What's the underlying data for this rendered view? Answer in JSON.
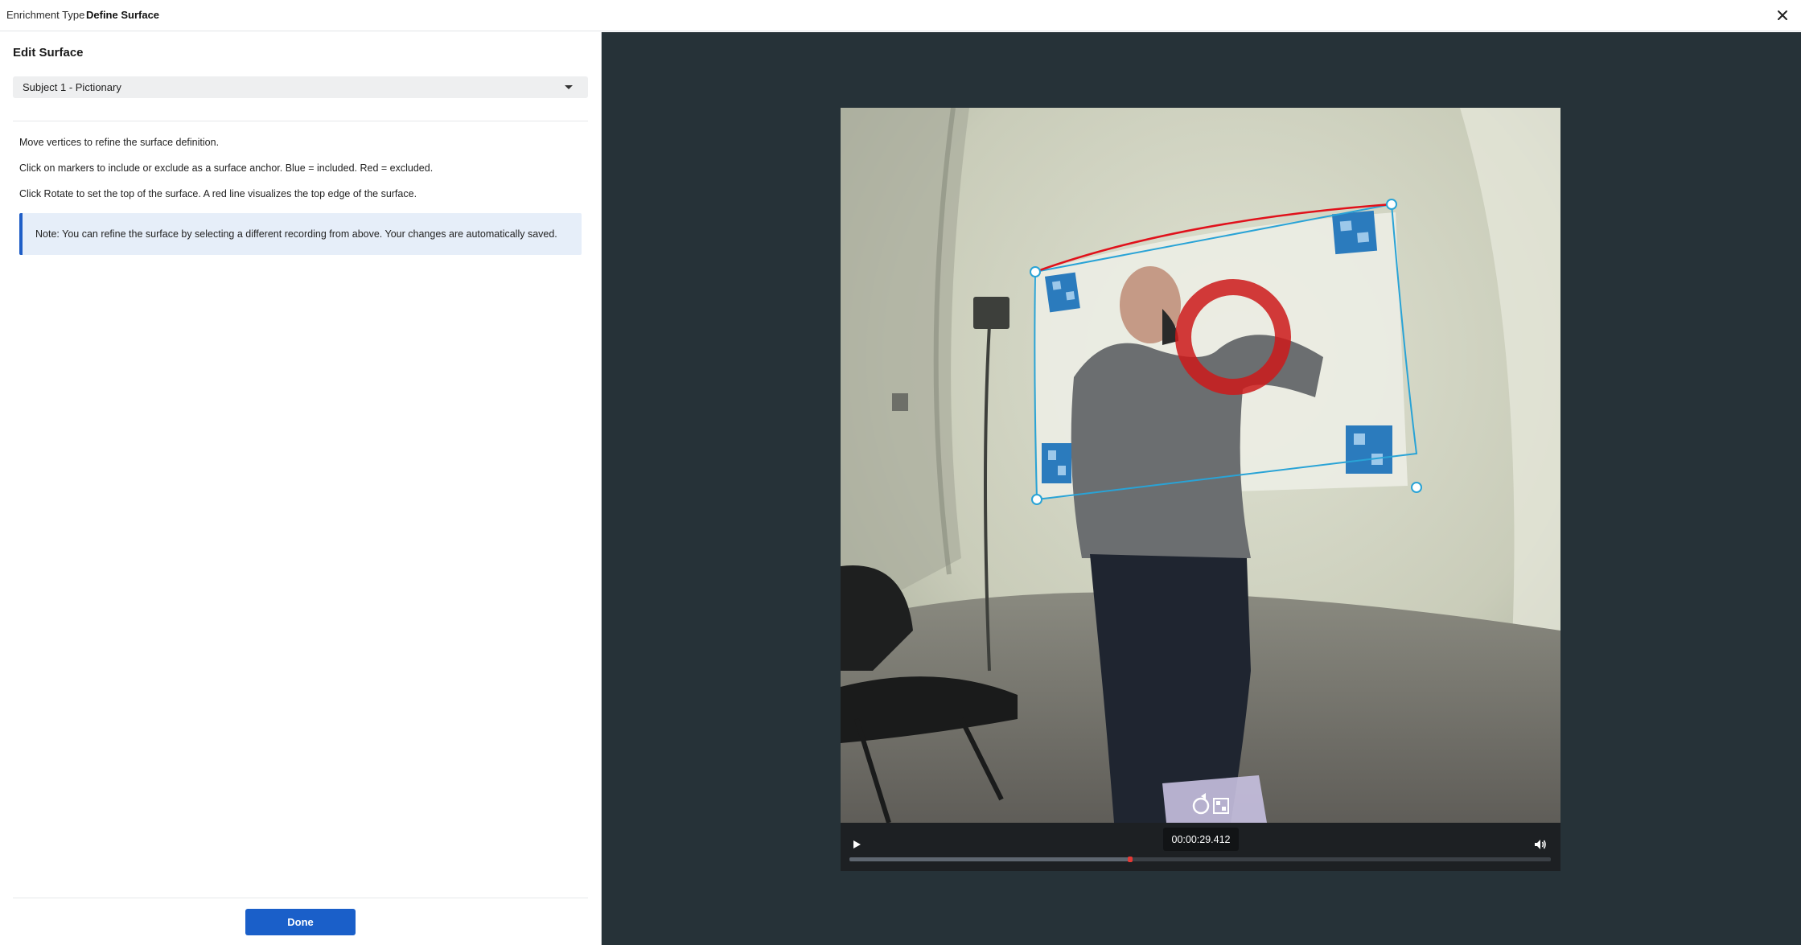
{
  "header": {
    "breadcrumb_parent": "Enrichment Type",
    "breadcrumb_current": "Define Surface"
  },
  "panel": {
    "title": "Edit Surface",
    "recording_select": {
      "value": "Subject 1 - Pictionary"
    },
    "instructions": [
      "Move vertices to refine the surface definition.",
      "Click on markers to include or exclude as a surface anchor. Blue = included. Red = excluded.",
      "Click Rotate to set the top of the surface. A red line visualizes the top edge of the surface."
    ],
    "note": "Note: You can refine the surface by selecting a different recording from above. Your changes are automatically saved.",
    "done_label": "Done"
  },
  "player": {
    "timestamp": "00:00:29.412",
    "progress_fraction": 0.4,
    "icons": {
      "play": "play-icon",
      "volume": "volume-icon",
      "rotate": "rotate-icon",
      "marker": "qr-marker-icon"
    },
    "colors": {
      "surface_edge": "#29a3d6",
      "top_edge": "#e0111b",
      "gaze": "#cc1a1a",
      "progress_knob": "#e53935"
    }
  }
}
